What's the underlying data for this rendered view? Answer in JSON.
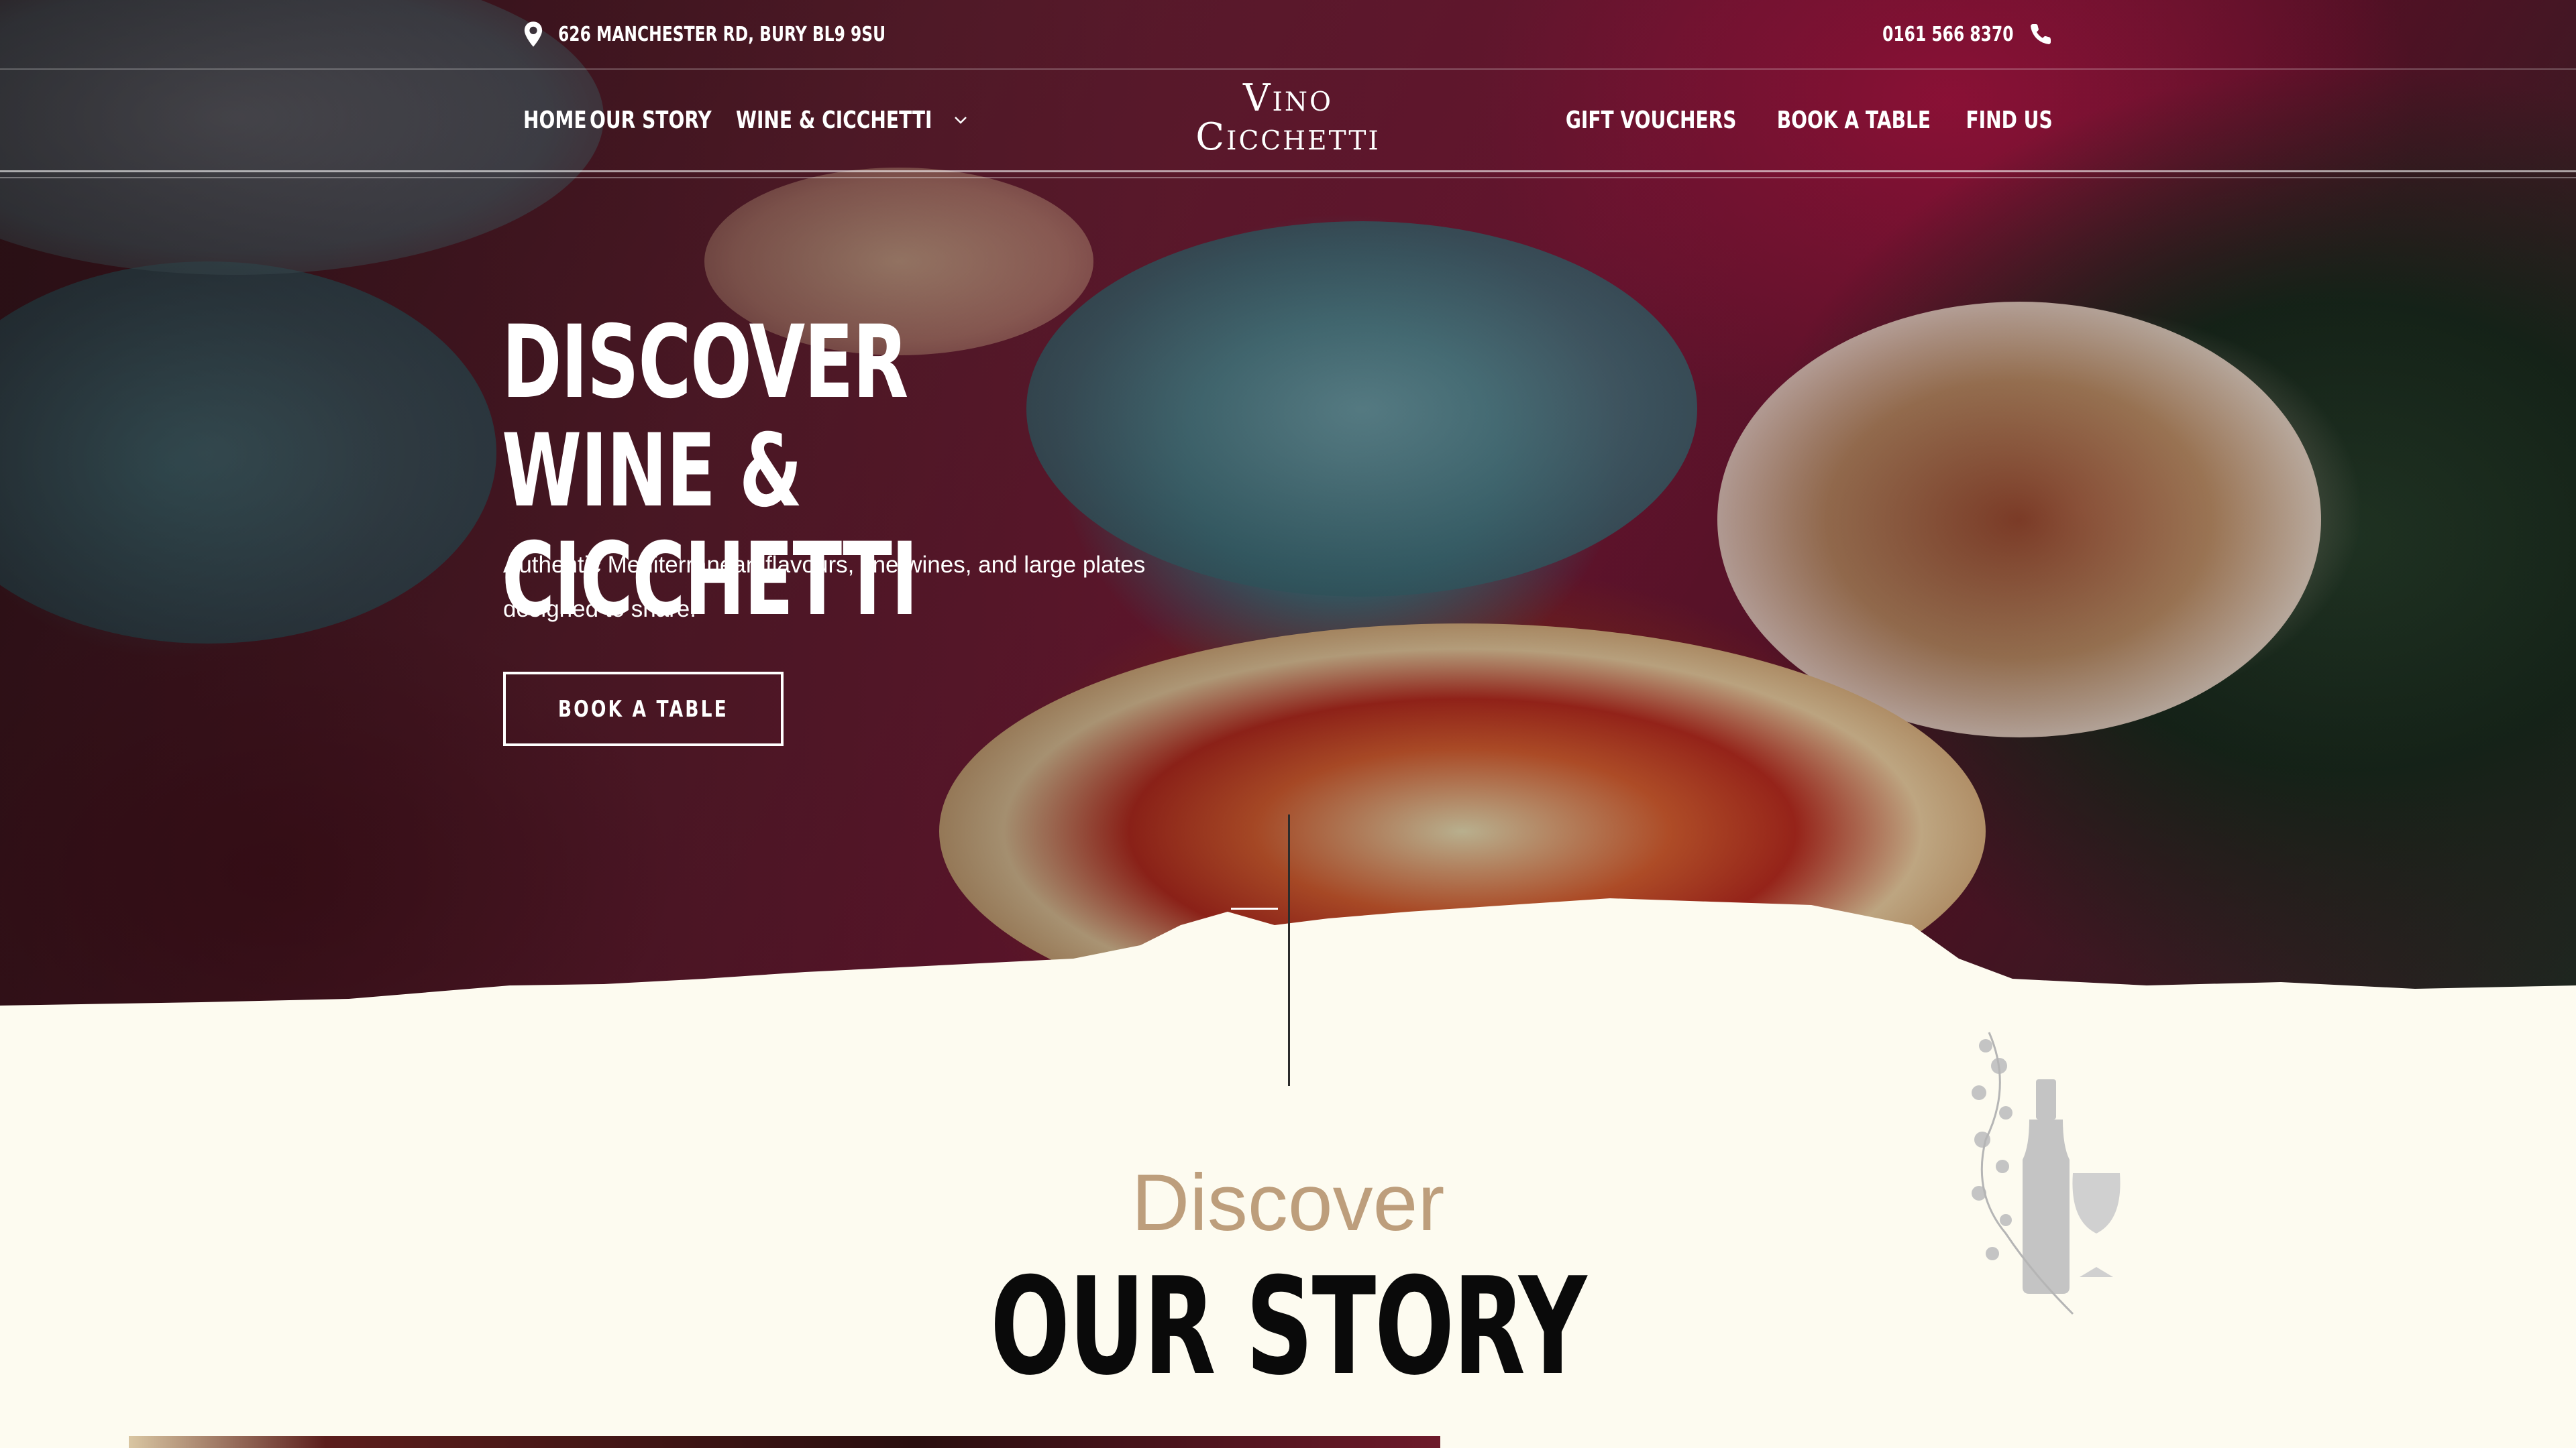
{
  "topbar": {
    "address": "626 MANCHESTER RD, BURY BL9 9SU",
    "phone": "0161 566 8370",
    "address_icon": "map-pin-icon",
    "phone_icon": "phone-icon"
  },
  "nav": {
    "left": [
      {
        "label": "HOME"
      },
      {
        "label": "OUR STORY"
      },
      {
        "label": "WINE & CICCHETTI"
      }
    ],
    "logo": {
      "line1": "Vino",
      "line2": "Cicchetti"
    },
    "right": [
      {
        "label": "GIFT VOUCHERS"
      },
      {
        "label": "BOOK A TABLE"
      },
      {
        "label": "FIND US"
      }
    ]
  },
  "hero": {
    "title": "DISCOVER WINE & CICCHETTI",
    "subtitle": "Authentic Mediterranean flavours, fine wines, and large plates designed to share.",
    "button_label": "BOOK A TABLE"
  },
  "story": {
    "kicker": "Discover",
    "heading": "OUR STORY"
  },
  "colors": {
    "background": "#fdfbf0",
    "accent": "#bd9e7c",
    "heading": "#0a0a0a"
  }
}
